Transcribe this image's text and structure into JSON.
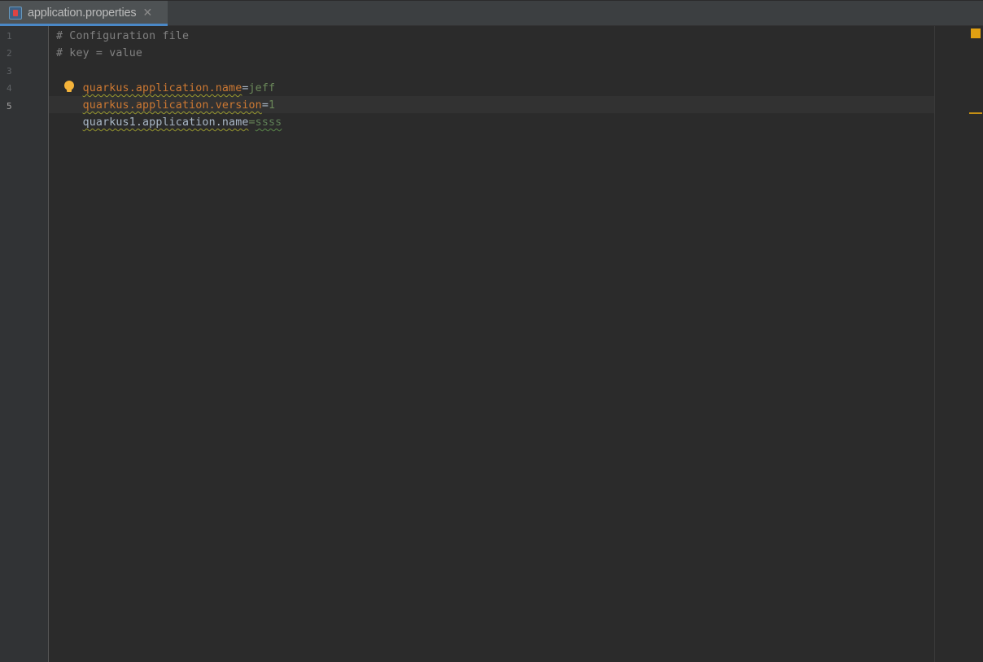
{
  "tab": {
    "filename": "application.properties",
    "close_glyph": "✕",
    "icon": "properties-file-icon"
  },
  "gutter": {
    "line_numbers": [
      "1",
      "2",
      "3",
      "4",
      "5"
    ],
    "active_line": "5"
  },
  "code": {
    "line1": "# Configuration file",
    "line2": "# key = value",
    "line3": {
      "key": "quarkus.application.name",
      "eq": "=",
      "value": "jeff"
    },
    "line4": {
      "key": "quarkus.application.version",
      "eq": "=",
      "value": "1"
    },
    "line5": {
      "key": "quarkus1.application.name",
      "eq": "=",
      "value": "ssss"
    }
  },
  "colors": {
    "background": "#2b2b2b",
    "comment": "#808080",
    "key": "#cc7832",
    "value": "#6a8759",
    "accent": "#4a88c7",
    "warning": "#e0a012"
  },
  "icons": {
    "intention": "lightbulb-icon",
    "inspection_status": "warning-status-icon"
  }
}
